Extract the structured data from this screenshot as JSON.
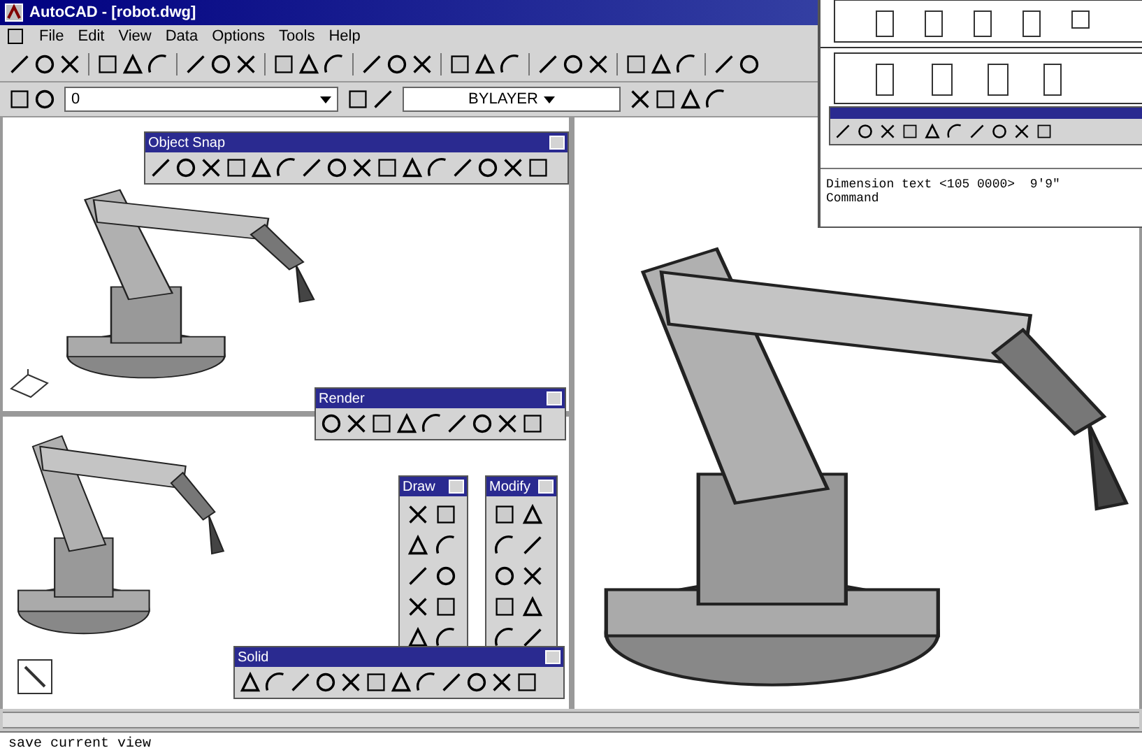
{
  "window": {
    "title": "AutoCAD - [robot.dwg]"
  },
  "menu": [
    "File",
    "Edit",
    "View",
    "Data",
    "Options",
    "Tools",
    "Help"
  ],
  "layer_toolbar": {
    "layer": "0",
    "linetype": "BYLAYER"
  },
  "toolbars": [
    {
      "title": "Object Snap",
      "kind": "horizontal"
    },
    {
      "title": "Render",
      "kind": "horizontal"
    },
    {
      "title": "Draw",
      "kind": "vertical"
    },
    {
      "title": "Modify",
      "kind": "vertical"
    },
    {
      "title": "Solid",
      "kind": "horizontal"
    }
  ],
  "second_window": {
    "command_lines": [
      "Dimension text <105 0000>  9'9\"",
      "Command"
    ]
  },
  "command_line": {
    "text": "save current view"
  }
}
